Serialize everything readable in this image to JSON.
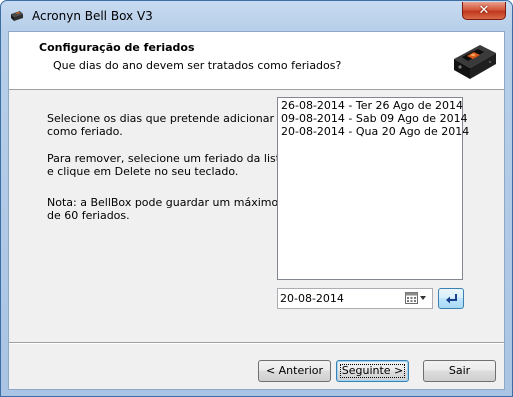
{
  "window": {
    "title": "Acronyn Bell Box V3",
    "close_symbol": "✕",
    "app_icon": "bellbox-app-icon"
  },
  "header": {
    "title": "Configuração de feriados",
    "subtitle": "Que dias do ano devem ser tratados como feriados?",
    "image": "bellbox-device-image"
  },
  "instructions": {
    "para1": [
      "Selecione os dias que pretende adicionar",
      "como feriado."
    ],
    "para2": [
      "Para remover, selecione um feriado da lista",
      "e clique em Delete no seu teclado."
    ],
    "para3": [
      "Nota: a BellBox pode guardar um máximo",
      "de 60 feriados."
    ]
  },
  "holidays": [
    "26-08-2014 - Ter 26 Ago de 2014",
    "09-08-2014 - Sab 09 Ago de 2014",
    "20-08-2014 - Qua 20 Ago de 2014"
  ],
  "date_picker": {
    "value": "20-08-2014",
    "icon": "calendar-icon"
  },
  "add_button": {
    "icon": "enter-arrow-icon"
  },
  "buttons": {
    "previous": "< Anterior",
    "next": "Seguinte >",
    "exit": "Sair"
  }
}
